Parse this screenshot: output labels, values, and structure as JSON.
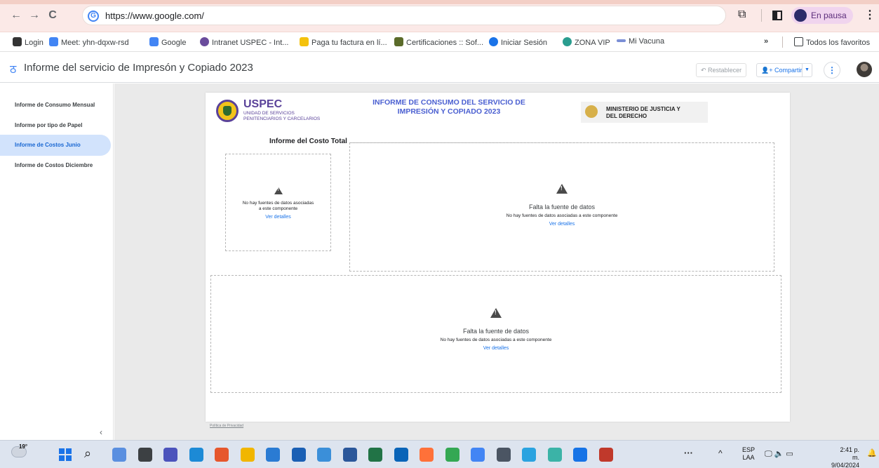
{
  "browser": {
    "url": "https://www.google.com/",
    "profile_status": "En pausa",
    "all_bookmarks": "Todos los favoritos",
    "bookmarks": [
      {
        "label": "Login",
        "color": "#333333"
      },
      {
        "label": "Meet: yhn-dqxw-rsd",
        "color": "#4285f4"
      },
      {
        "label": "Google",
        "color": "#4285f4"
      },
      {
        "label": "Intranet USPEC - Int...",
        "color": "#6a4c9c"
      },
      {
        "label": "Paga tu factura en lí...",
        "color": "#f4c20d"
      },
      {
        "label": "Certificaciones :: Sof...",
        "color": "#5b6b2a"
      },
      {
        "label": "Iniciar Sesión",
        "color": "#1a73e8"
      },
      {
        "label": "ZONA VIP",
        "color": "#2a9d8f"
      },
      {
        "label": "Mi Vacuna",
        "color": "#7b8fd6"
      }
    ]
  },
  "app": {
    "title": "Informe del servicio de Impresón y Copiado 2023",
    "reset_label": "Restablecer",
    "share_label": "Compartir"
  },
  "nav": {
    "items": [
      {
        "label": "Informe de Consumo Mensual"
      },
      {
        "label": "Informe por tipo de Papel"
      },
      {
        "label": "Informe de Costos Junio"
      },
      {
        "label": "Informe de Costos Diciembre"
      }
    ],
    "active_index": 2,
    "collapse_glyph": "‹"
  },
  "report": {
    "org_name": "USPEC",
    "org_sub_1": "UNIDAD DE SERVICIOS",
    "org_sub_2": "PENITENCIARIOS Y CARCELARIOS",
    "title_1": "INFORME DE CONSUMO DEL SERVICIO DE",
    "title_2": "IMPRESIÓN Y COPIADO 2023",
    "ministry_1": "MINISTERIO DE JUSTICIA Y",
    "ministry_2": "DEL DERECHO",
    "section_title": "Informe del Costo Total",
    "small_placeholder": {
      "text_1": "No hay fuentes de datos asociadas",
      "text_2": "a este componente",
      "link": "Ver detalles"
    },
    "placeholder": {
      "title": "Falta la fuente de datos",
      "text": "No hay fuentes de datos asociadas a este componente",
      "link": "Ver detalles"
    },
    "privacy": "Política de Privacidad"
  },
  "taskbar": {
    "temperature": "19°",
    "lang_1": "ESP",
    "lang_2": "LAA",
    "time": "2:41 p. m.",
    "date": "9/04/2024",
    "apps": [
      {
        "name": "widgets-icon",
        "color": "#5a8fe0"
      },
      {
        "name": "files-icon",
        "color": "#3c4043"
      },
      {
        "name": "teams-icon",
        "color": "#4b53bc"
      },
      {
        "name": "edge-icon",
        "color": "#1c8ad6"
      },
      {
        "name": "store-grid-icon",
        "color": "#e6572d"
      },
      {
        "name": "folder-icon",
        "color": "#f1b600"
      },
      {
        "name": "store-icon",
        "color": "#2a7bd3"
      },
      {
        "name": "mail-icon",
        "color": "#1a5fb4"
      },
      {
        "name": "voice-icon",
        "color": "#3b8fd9"
      },
      {
        "name": "word-icon",
        "color": "#2b579a"
      },
      {
        "name": "excel-icon",
        "color": "#217346"
      },
      {
        "name": "outlook-icon",
        "color": "#0a64b8"
      },
      {
        "name": "firefox-icon",
        "color": "#ff7139"
      },
      {
        "name": "chrome-icon",
        "color": "#34a853"
      },
      {
        "name": "chrome-dev-icon",
        "color": "#4285f4"
      },
      {
        "name": "calculator-icon",
        "color": "#4b5563"
      },
      {
        "name": "telegram-icon",
        "color": "#2aa3e0"
      },
      {
        "name": "photos-icon",
        "color": "#3bb3a7"
      },
      {
        "name": "browser-icon",
        "color": "#1673e6"
      },
      {
        "name": "snipping-icon",
        "color": "#c0392b"
      }
    ]
  }
}
